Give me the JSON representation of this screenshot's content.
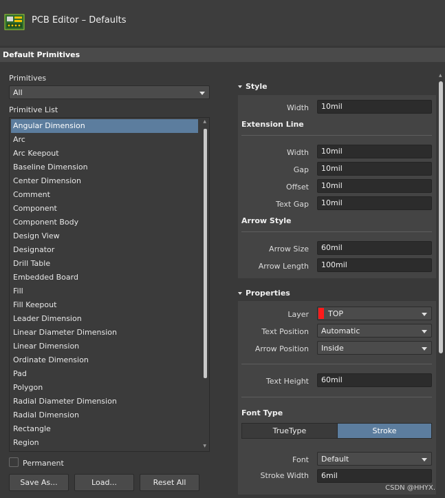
{
  "window": {
    "title": "PCB Editor – Defaults",
    "icon": "pcb-board-icon"
  },
  "section_title": "Default Primitives",
  "primitives": {
    "label": "Primitives",
    "filter_value": "All",
    "list_label": "Primitive List",
    "items": [
      "Angular Dimension",
      "Arc",
      "Arc Keepout",
      "Baseline Dimension",
      "Center Dimension",
      "Comment",
      "Component",
      "Component Body",
      "Design View",
      "Designator",
      "Drill Table",
      "Embedded Board",
      "Fill",
      "Fill Keepout",
      "Leader Dimension",
      "Linear Diameter Dimension",
      "Linear Dimension",
      "Ordinate Dimension",
      "Pad",
      "Polygon",
      "Radial Diameter Dimension",
      "Radial Dimension",
      "Rectangle",
      "Region"
    ],
    "selected_index": 0,
    "permanent_label": "Permanent",
    "permanent_checked": false
  },
  "buttons": {
    "save_as": "Save As...",
    "load": "Load...",
    "reset_all": "Reset All"
  },
  "style": {
    "title": "Style",
    "width_label": "Width",
    "width_value": "10mil",
    "extension_line": {
      "title": "Extension Line",
      "width_label": "Width",
      "width_value": "10mil",
      "gap_label": "Gap",
      "gap_value": "10mil",
      "offset_label": "Offset",
      "offset_value": "10mil",
      "text_gap_label": "Text Gap",
      "text_gap_value": "10mil"
    },
    "arrow_style": {
      "title": "Arrow Style",
      "arrow_size_label": "Arrow Size",
      "arrow_size_value": "60mil",
      "arrow_length_label": "Arrow Length",
      "arrow_length_value": "100mil"
    }
  },
  "properties": {
    "title": "Properties",
    "layer_label": "Layer",
    "layer_value": "TOP",
    "layer_color": "#ff1a1a",
    "text_position_label": "Text Position",
    "text_position_value": "Automatic",
    "arrow_position_label": "Arrow Position",
    "arrow_position_value": "Inside",
    "text_height_label": "Text Height",
    "text_height_value": "60mil",
    "font_type": {
      "title": "Font Type",
      "options": [
        "TrueType",
        "Stroke"
      ],
      "selected": "Stroke"
    },
    "font_label": "Font",
    "font_value": "Default",
    "stroke_width_label": "Stroke Width",
    "stroke_width_value": "6mil"
  },
  "colors": {
    "accent": "#5c7d9e",
    "panel": "#444444",
    "background": "#393939"
  },
  "watermark": "CSDN @HHYX."
}
